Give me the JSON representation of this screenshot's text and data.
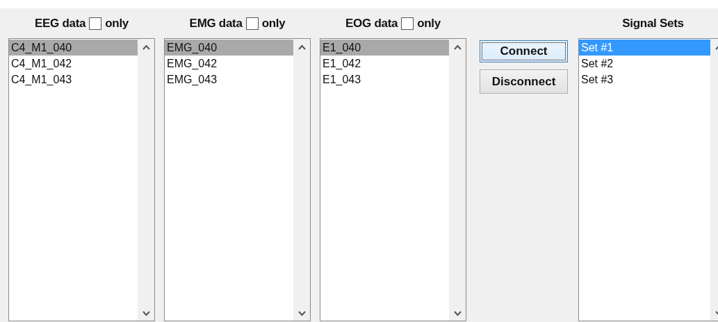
{
  "channel_lists": [
    {
      "title": "EEG data",
      "only_label": "only",
      "only_checked": false,
      "focused": false,
      "items": [
        {
          "label": "C4_M1_040",
          "selected": true
        },
        {
          "label": "C4_M1_042",
          "selected": false
        },
        {
          "label": "C4_M1_043",
          "selected": false
        }
      ]
    },
    {
      "title": "EMG data",
      "only_label": "only",
      "only_checked": false,
      "focused": false,
      "items": [
        {
          "label": "EMG_040",
          "selected": true
        },
        {
          "label": "EMG_042",
          "selected": false
        },
        {
          "label": "EMG_043",
          "selected": false
        }
      ]
    },
    {
      "title": "EOG data",
      "only_label": "only",
      "only_checked": false,
      "focused": false,
      "items": [
        {
          "label": "E1_040",
          "selected": true
        },
        {
          "label": "E1_042",
          "selected": false
        },
        {
          "label": "E1_043",
          "selected": false
        }
      ]
    }
  ],
  "buttons": [
    {
      "label": "Connect",
      "focused": true
    },
    {
      "label": "Disconnect",
      "focused": false
    }
  ],
  "signal_sets": {
    "title": "Signal Sets",
    "focused": true,
    "items": [
      {
        "label": "Set #1",
        "selected": true
      },
      {
        "label": "Set #2",
        "selected": false
      },
      {
        "label": "Set #3",
        "selected": false
      }
    ]
  }
}
